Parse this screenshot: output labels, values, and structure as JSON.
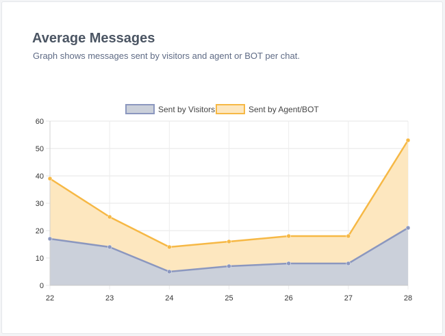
{
  "header": {
    "title": "Average Messages",
    "subtitle": "Graph shows messages sent by visitors and agent or BOT per chat."
  },
  "chart_data": {
    "type": "area",
    "title": "",
    "xlabel": "",
    "ylabel": "",
    "categories": [
      "22",
      "23",
      "24",
      "25",
      "26",
      "27",
      "28"
    ],
    "ylim": [
      0,
      60
    ],
    "yticks": [
      0,
      10,
      20,
      30,
      40,
      50,
      60
    ],
    "grid": true,
    "legend_position": "top-center",
    "series": [
      {
        "name": "Sent by Visitors",
        "values": [
          17,
          14,
          5,
          7,
          8,
          8,
          21
        ],
        "line_color": "#8b97bf",
        "fill_color": "#cbd0da"
      },
      {
        "name": "Sent by Agent/BOT",
        "values": [
          39,
          25,
          14,
          16,
          18,
          18,
          53
        ],
        "line_color": "#f6b845",
        "fill_color": "#fde7bf"
      }
    ]
  }
}
